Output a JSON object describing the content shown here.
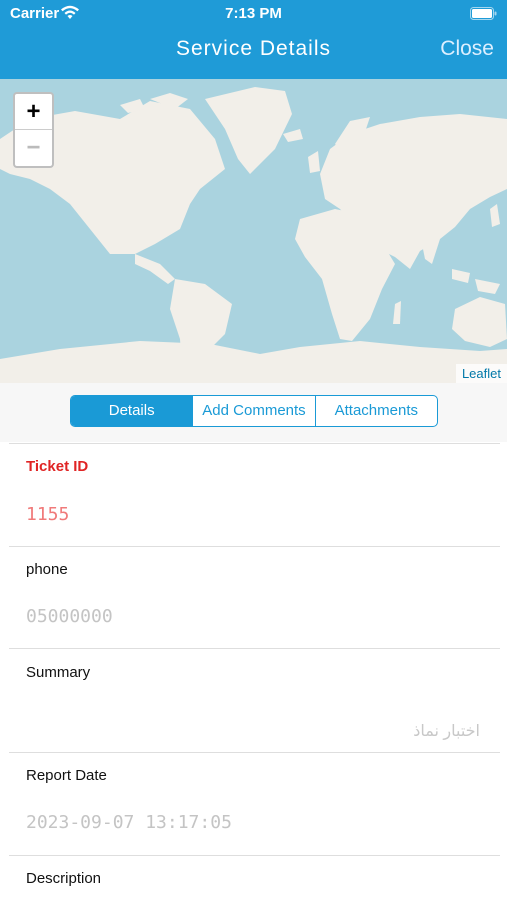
{
  "status_bar": {
    "carrier": "Carrier",
    "time": "7:13 PM"
  },
  "nav": {
    "title": "Service Details",
    "close_label": "Close"
  },
  "map": {
    "zoom_in": "+",
    "zoom_out": "−",
    "attribution": "Leaflet"
  },
  "tabs": [
    "Details",
    "Add Comments",
    "Attachments"
  ],
  "fields": {
    "ticket": {
      "label": "Ticket ID",
      "value": "1155"
    },
    "phone": {
      "label": "phone",
      "value": "05000000"
    },
    "summary": {
      "label": "Summary",
      "value": "اختبار نماذ"
    },
    "report_date": {
      "label": "Report Date",
      "value": "2023-09-07 13:17:05"
    },
    "description": {
      "label": "Description"
    }
  },
  "colors": {
    "header": "#1f9bd7",
    "accent": "#1a9ad6",
    "ocean": "#aad3df",
    "land": "#f2efe9",
    "required": "#e02424"
  }
}
